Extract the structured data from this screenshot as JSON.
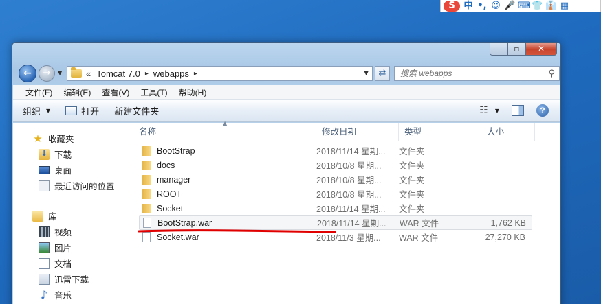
{
  "ime": {
    "logo": "S",
    "items": [
      "中",
      "•,",
      "☺",
      "🎤",
      "⌨",
      "👕",
      "👔",
      "▦"
    ]
  },
  "window": {
    "minimize": "—",
    "maximize": "▫",
    "close": "✕"
  },
  "address": {
    "prefix": "«",
    "crumbs": [
      "Tomcat 7.0",
      "webapps"
    ],
    "sep": "▸",
    "search_placeholder": "搜索 webapps"
  },
  "menu": [
    "文件(F)",
    "编辑(E)",
    "查看(V)",
    "工具(T)",
    "帮助(H)"
  ],
  "commands": {
    "organize": "组织",
    "open": "打开",
    "new_folder": "新建文件夹"
  },
  "nav": {
    "favorites": "收藏夹",
    "downloads": "下载",
    "desktop": "桌面",
    "recent": "最近访问的位置",
    "libraries": "库",
    "videos": "视频",
    "pictures": "图片",
    "documents": "文档",
    "xunlei": "迅雷下载",
    "music": "音乐"
  },
  "columns": {
    "name": "名称",
    "date": "修改日期",
    "type": "类型",
    "size": "大小"
  },
  "files": [
    {
      "name": "BootStrap",
      "date": "2018/11/14 星期...",
      "type": "文件夹",
      "size": "",
      "kind": "folder"
    },
    {
      "name": "docs",
      "date": "2018/10/8 星期...",
      "type": "文件夹",
      "size": "",
      "kind": "folder"
    },
    {
      "name": "manager",
      "date": "2018/10/8 星期...",
      "type": "文件夹",
      "size": "",
      "kind": "folder"
    },
    {
      "name": "ROOT",
      "date": "2018/10/8 星期...",
      "type": "文件夹",
      "size": "",
      "kind": "folder"
    },
    {
      "name": "Socket",
      "date": "2018/11/14 星期...",
      "type": "文件夹",
      "size": "",
      "kind": "folder"
    },
    {
      "name": "BootStrap.war",
      "date": "2018/11/14 星期...",
      "type": "WAR 文件",
      "size": "1,762 KB",
      "kind": "file",
      "selected": true
    },
    {
      "name": "Socket.war",
      "date": "2018/11/3 星期...",
      "type": "WAR 文件",
      "size": "27,270 KB",
      "kind": "file"
    }
  ],
  "colors": {
    "desktop": "#1f6bbf",
    "annotation_line": "#e00000"
  }
}
